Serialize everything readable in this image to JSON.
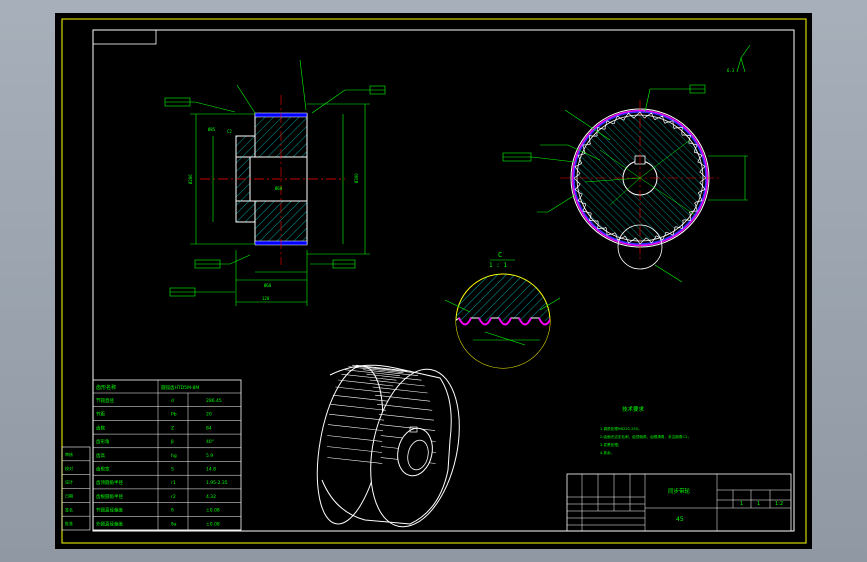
{
  "colors": {
    "background": "#000000",
    "frame": "#ffff00",
    "text": "#00ff00",
    "hatch": "#00ffff",
    "centerline": "#ff0000",
    "dimension": "#00ff00",
    "tooth_fill": "#4040ff",
    "tooth_outline": "#ff00ff",
    "outline": "#ffffff",
    "viewport": "#9aa3ad"
  },
  "detail_view": {
    "label": "C",
    "scale": "1 : 1"
  },
  "parameter_table": {
    "header": [
      "齿形名称",
      "圆弧齿HTD5M-8M"
    ],
    "rows": [
      {
        "name": "节圆直径",
        "symbol": "d",
        "value": "286.45"
      },
      {
        "name": "节距",
        "symbol": "Pb",
        "value": "20"
      },
      {
        "name": "齿数",
        "symbol": "Z",
        "value": "84"
      },
      {
        "name": "齿形角",
        "symbol": "β",
        "value": "40°"
      },
      {
        "name": "齿高",
        "symbol": "hg",
        "value": "5.9"
      },
      {
        "name": "齿根宽",
        "symbol": "S",
        "value": "14.8"
      },
      {
        "name": "齿顶圆角半径",
        "symbol": "r1",
        "value": "1.95-2.35"
      },
      {
        "name": "齿根圆角半径",
        "symbol": "r2",
        "value": "4.32"
      },
      {
        "name": "节圆直径偏差",
        "symbol": "δ",
        "value": "±0.08"
      },
      {
        "name": "外圆直径偏差",
        "symbol": "δa",
        "value": "±0.08"
      }
    ]
  },
  "technical_requirements": {
    "title": "技术要求",
    "items": [
      "1.调质处理HB220-250；",
      "2.齿面光洁无毛刺，齿顶倒角，齿根清角，未注倒角C1；",
      "3.发黑处理；",
      "4.其余。"
    ]
  },
  "title_block": {
    "part_name": "同步带轮",
    "material": "45",
    "scale": "1:2",
    "sheet": "1",
    "quantity": "1"
  },
  "revision_stamps": [
    "审核",
    "校对",
    "设计",
    "日期",
    "签名",
    "批准"
  ]
}
